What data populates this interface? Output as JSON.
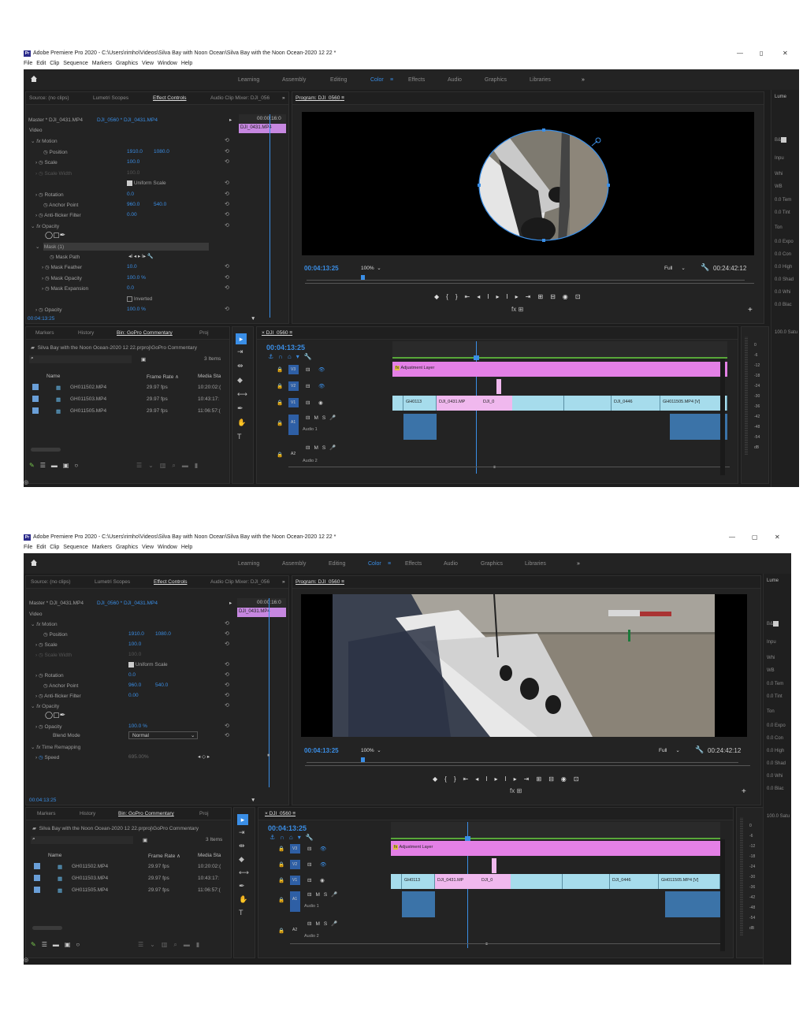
{
  "shots": [
    {
      "title": "Adobe Premiere Pro 2020 - C:\\Users\\rimho\\Videos\\Silva Bay with Noon Ocean\\Silva Bay with the Noon Ocean-2020 12 22 *",
      "menu": [
        "File",
        "Edit",
        "Clip",
        "Sequence",
        "Markers",
        "Graphics",
        "View",
        "Window",
        "Help"
      ],
      "workspaces": [
        "Learning",
        "Assembly",
        "Editing",
        "Color",
        "Effects",
        "Audio",
        "Graphics",
        "Libraries"
      ],
      "active_workspace": "Color",
      "source_tabs": [
        "Source: (no clips)",
        "Lumetri Scopes",
        "Effect Controls",
        "Audio Clip Mixer: DJI_056"
      ],
      "master_label": "Master * DJI_0431.MP4",
      "seq_label": "DJI_0560 * DJI_0431.MP4",
      "ec_timecode": "00:00:16:0",
      "clip_chip": "DJI_0431.MP4",
      "video_label": "Video",
      "rows": [
        {
          "label": "Motion"
        },
        {
          "label": "Position",
          "v1": "1910.0",
          "v2": "1080.0"
        },
        {
          "label": "Scale",
          "v1": "100.0"
        },
        {
          "label": "Scale Width",
          "v1": "100.0"
        },
        {
          "label": "Uniform Scale"
        },
        {
          "label": "Rotation",
          "v1": "0.0"
        },
        {
          "label": "Anchor Point",
          "v1": "960.0",
          "v2": "540.0"
        },
        {
          "label": "Anti-flicker Filter",
          "v1": "0.00"
        },
        {
          "label": "Opacity"
        },
        {
          "label": "Mask (1)"
        },
        {
          "label": "Mask Path"
        },
        {
          "label": "Mask Feather",
          "v1": "10.0"
        },
        {
          "label": "Mask Opacity",
          "v1": "100.0 %"
        },
        {
          "label": "Mask Expansion",
          "v1": "0.0"
        },
        {
          "label": "Inverted"
        },
        {
          "label": "Opacity",
          "v1": "100.0 %"
        }
      ],
      "ec_bottom_tc": "00:04:13:25",
      "program_label": "Program: DJI_0560",
      "prog_tc": "00:04:13:25",
      "zoom": "100%",
      "quality": "Full",
      "duration": "00:24:42:12",
      "proj_tabs": [
        "Markers",
        "History",
        "Bin: GoPro Commentary",
        "Proj"
      ],
      "proj_path": "Silva Bay with the Noon Ocean-2020 12 22.prproj\\GoPro Commentary",
      "items_count": "3 Items",
      "cols": [
        "Name",
        "Frame Rate",
        "Media Sta"
      ],
      "files": [
        {
          "name": "GH011502.MP4",
          "fps": "29.97 fps",
          "start": "10:20:02:("
        },
        {
          "name": "GH011503.MP4",
          "fps": "29.97 fps",
          "start": "10:43:17:"
        },
        {
          "name": "GH011505.MP4",
          "fps": "29.97 fps",
          "start": "11:06:57:("
        }
      ],
      "timeline_tab": "DJI_0560",
      "tl_tc": "00:04:13:25",
      "tracks": [
        "V3",
        "V2",
        "V1",
        "A1",
        "A2"
      ],
      "audio_names": [
        "Audio 1",
        "Audio 2"
      ],
      "adj_label": "Adjustment Layer",
      "clips": [
        "GH0113",
        "DJI_0431.MP",
        "DJI_0",
        "DJI_0446",
        "GH011505.MP4 [V]"
      ],
      "meter": [
        "0",
        "-6",
        "-12",
        "-18",
        "-24",
        "-30",
        "-36",
        "-42",
        "-48",
        "-54",
        "dB"
      ],
      "right_strip": [
        "Lume",
        "B&",
        "Inpu",
        "Whi",
        "WB",
        "0.0 Tem",
        "0.0 Tint",
        "Ton",
        "0.0 Expo",
        "0.0 Con",
        "0.0 High",
        "0.0 Shad",
        "0.0 Whi",
        "0.0 Blac",
        "100.0 Satu"
      ]
    },
    {
      "title": "Adobe Premiere Pro 2020 - C:\\Users\\rimho\\Videos\\Silva Bay with Noon Ocean\\Silva Bay with the Noon Ocean-2020 12 22 *",
      "menu": [
        "File",
        "Edit",
        "Clip",
        "Sequence",
        "Markers",
        "Graphics",
        "View",
        "Window",
        "Help"
      ],
      "workspaces": [
        "Learning",
        "Assembly",
        "Editing",
        "Color",
        "Effects",
        "Audio",
        "Graphics",
        "Libraries"
      ],
      "active_workspace": "Color",
      "source_tabs": [
        "Source: (no clips)",
        "Lumetri Scopes",
        "Effect Controls",
        "Audio Clip Mixer: DJI_056"
      ],
      "master_label": "Master * DJI_0431.MP4",
      "seq_label": "DJI_0560 * DJI_0431.MP4",
      "ec_timecode": "00:00:16:0",
      "clip_chip": "DJI_0431.MP4",
      "video_label": "Video",
      "rows": [
        {
          "label": "Motion"
        },
        {
          "label": "Position",
          "v1": "1910.0",
          "v2": "1080.0"
        },
        {
          "label": "Scale",
          "v1": "100.0"
        },
        {
          "label": "Scale Width",
          "v1": "100.0"
        },
        {
          "label": "Uniform Scale"
        },
        {
          "label": "Rotation",
          "v1": "0.0"
        },
        {
          "label": "Anchor Point",
          "v1": "960.0",
          "v2": "540.0"
        },
        {
          "label": "Anti-flicker Filter",
          "v1": "0.00"
        },
        {
          "label": "Opacity"
        },
        {
          "label": "Opacity",
          "v1": "100.0 %"
        },
        {
          "label": "Blend Mode",
          "v1": "Normal"
        },
        {
          "label": "Time Remapping"
        },
        {
          "label": "Speed",
          "v1": "695.00%"
        }
      ],
      "ec_bottom_tc": "00:04:13:25",
      "program_label": "Program: DJI_0560",
      "prog_tc": "00:04:13:25",
      "zoom": "100%",
      "quality": "Full",
      "duration": "00:24:42:12",
      "proj_tabs": [
        "Markers",
        "History",
        "Bin: GoPro Commentary",
        "Proj"
      ],
      "proj_path": "Silva Bay with the Noon Ocean-2020 12 22.prproj\\GoPro Commentary",
      "items_count": "3 Items",
      "cols": [
        "Name",
        "Frame Rate",
        "Media Sta"
      ],
      "files": [
        {
          "name": "GH011502.MP4",
          "fps": "29.97 fps",
          "start": "10:20:02:("
        },
        {
          "name": "GH011503.MP4",
          "fps": "29.97 fps",
          "start": "10:43:17:"
        },
        {
          "name": "GH011505.MP4",
          "fps": "29.97 fps",
          "start": "11:06:57:("
        }
      ],
      "timeline_tab": "DJI_0560",
      "tl_tc": "00:04:13:25",
      "tracks": [
        "V3",
        "V2",
        "V1",
        "A1",
        "A2"
      ],
      "audio_names": [
        "Audio 1",
        "Audio 2"
      ],
      "adj_label": "Adjustment Layer",
      "clips": [
        "GH0113",
        "DJI_0431.MP",
        "DJI_0",
        "DJI_0446",
        "GH011505.MP4 [V]"
      ],
      "meter": [
        "0",
        "-6",
        "-12",
        "-18",
        "-24",
        "-30",
        "-36",
        "-42",
        "-48",
        "-54",
        "dB"
      ],
      "right_strip": [
        "Lume",
        "B&",
        "Inpu",
        "Whi",
        "WB",
        "0.0 Tem",
        "0.0 Tint",
        "Ton",
        "0.0 Expo",
        "0.0 Con",
        "0.0 High",
        "0.0 Shad",
        "0.0 Whi",
        "0.0 Blac",
        "100.0 Satu"
      ]
    }
  ]
}
